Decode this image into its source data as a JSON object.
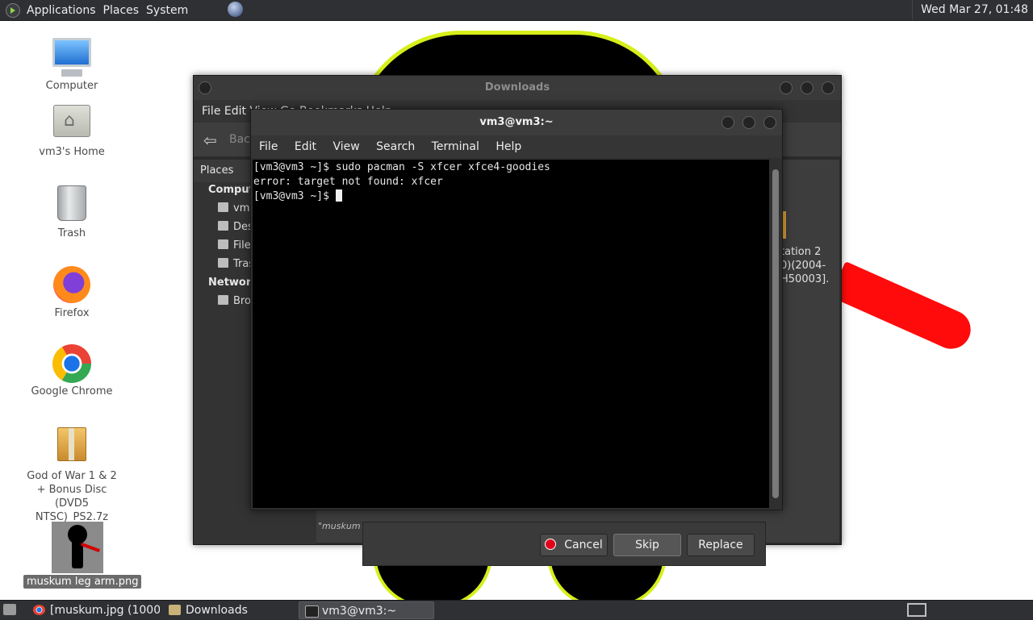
{
  "top_panel": {
    "menus": [
      "Applications",
      "Places",
      "System"
    ],
    "clock": "Wed Mar 27, 01:48"
  },
  "desktop": {
    "icons": [
      {
        "label": "Computer"
      },
      {
        "label": "vm3's Home"
      },
      {
        "label": "Trash"
      },
      {
        "label": "Firefox"
      },
      {
        "label": "Google Chrome"
      },
      {
        "label": "God of War 1 & 2 + Bonus Disc (DVD5 NTSC)_PS2.7z"
      },
      {
        "label": "muskum leg arm.png"
      }
    ]
  },
  "downloads_window": {
    "title": "Downloads",
    "menubar": "File   Edit   View   Go   Bookmarks   Help",
    "back_label": "Back",
    "sidebar_header": "Places",
    "sections": [
      "Computer",
      "Network"
    ],
    "computer_items": [
      "vm3",
      "Desktop",
      "File System",
      "Trash"
    ],
    "network_items": [
      "Browse Network"
    ],
    "peek_text": [
      "tation 2",
      "0)(2004-",
      "H50003]."
    ],
    "status_text": "\"muskum"
  },
  "replace_dialog": {
    "cancel_label": "Cancel",
    "skip_label": "Skip",
    "replace_label": "Replace"
  },
  "terminal": {
    "title": "vm3@vm3:~",
    "menus": [
      "File",
      "Edit",
      "View",
      "Search",
      "Terminal",
      "Help"
    ],
    "lines": [
      "[vm3@vm3 ~]$ sudo pacman -S xfcer xfce4-goodies",
      "error: target not found: xfcer",
      "[vm3@vm3 ~]$ "
    ]
  },
  "taskbar": {
    "tasks": [
      "[muskum.jpg (1000...",
      "Downloads",
      "vm3@vm3:~"
    ]
  },
  "colors": {
    "panel_bg": "#2f3034",
    "terminal_bg": "#000000",
    "accent_yellow": "#d6ef1a",
    "accent_red": "#ff0b0b"
  }
}
